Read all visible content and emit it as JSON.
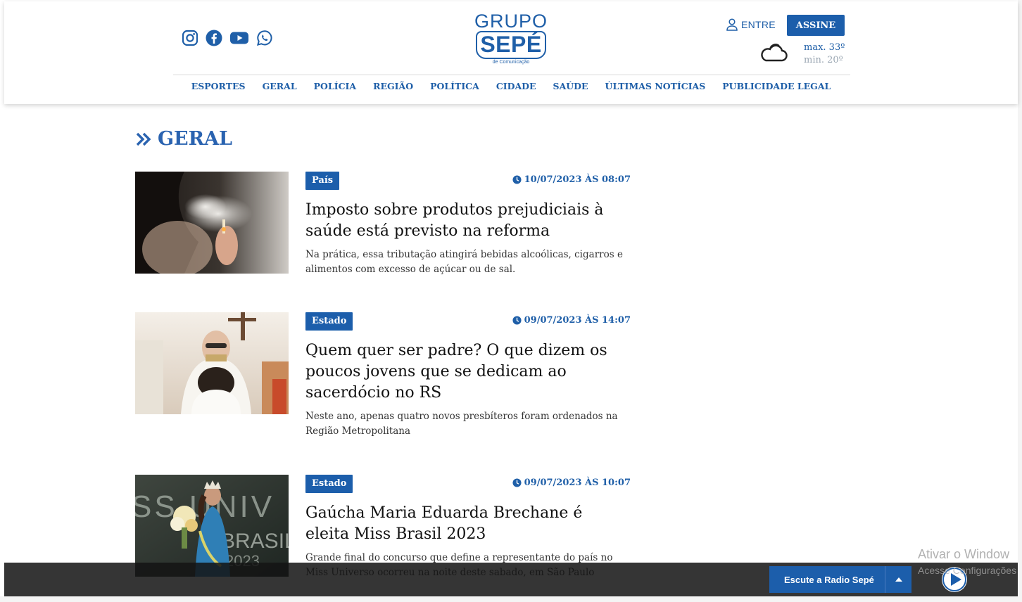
{
  "header": {
    "logo": {
      "line1": "GRUPO",
      "line2": "SEPÉ",
      "line3": "de Comunicação"
    },
    "social": [
      "instagram-icon",
      "facebook-icon",
      "youtube-icon",
      "whatsapp-icon"
    ],
    "login_label": "ENTRE",
    "subscribe_label": "ASSINE",
    "weather": {
      "max": "max. 33º",
      "min": "min. 20º",
      "icon": "cloud-icon"
    },
    "nav": [
      "ESPORTES",
      "GERAL",
      "POLÍCIA",
      "REGIÃO",
      "POLÍTICA",
      "CIDADE",
      "SAÚDE",
      "ÚLTIMAS NOTÍCIAS",
      "PUBLICIDADE LEGAL"
    ]
  },
  "section": {
    "title": "GERAL"
  },
  "articles": [
    {
      "category": "País",
      "date": "10/07/2023 ÀS 08:07",
      "title": "Imposto sobre produtos prejudiciais à saúde está previsto na reforma",
      "summary": "Na prática, essa tributação atingirá bebidas alcoólicas, cigarros e alimentos com excesso de açúcar ou de sal."
    },
    {
      "category": "Estado",
      "date": "09/07/2023 ÀS 14:07",
      "title": "Quem quer ser padre? O que dizem os poucos jovens que se dedicam ao sacerdócio no RS",
      "summary": "Neste ano, apenas quatro novos presbíteros foram ordenados na Região Metropolitana"
    },
    {
      "category": "Estado",
      "date": "09/07/2023 ÀS 10:07",
      "title": "Gaúcha Maria Eduarda Brechane é eleita Miss Brasil 2023",
      "summary": "Grande final do concurso que define a representante do país no Miss Universo ocorreu na noite deste sabado, em São Paulo",
      "thumb_text": {
        "top": "SS UNIV",
        "mid": "BRASIL",
        "bot": "2023"
      }
    }
  ],
  "player": {
    "label": "Escute a Radio Sepé"
  },
  "watermark": {
    "line1": "Ativar o Window",
    "line2": "Acesse Configurações"
  },
  "colors": {
    "brand": "#1c5eab",
    "brand_text": "#1f5fa8"
  }
}
